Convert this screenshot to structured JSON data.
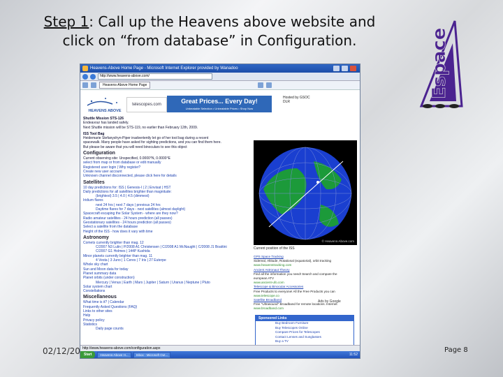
{
  "slide": {
    "title_step": "Step 1",
    "title_rest_line1": ": Call up the Heavens above website and",
    "title_line2": "click on “from database” in Configuration.",
    "date": "02/12/20",
    "page": "Page 8",
    "logo_text": "Espace"
  },
  "browser": {
    "title": "Heavens-Above Home Page - Microsoft Internet Explorer provided by Wanadoo",
    "address": "http://www.heavens-above.com/",
    "tab": "Heavens-Above Home Page",
    "status_url": "http://www.heavens-above.com/configuration.aspx",
    "start_label": "Start",
    "task1": "Heavens-Above H...",
    "task2": "Inbox - Microsoft Out...",
    "clock": "11:52"
  },
  "site": {
    "logo_text": "HEAVENS ABOVE",
    "ad1_text": "telescopes.com",
    "ad2_title": "Great Prices... Every Day!",
    "ad2_sub": "Unbeatable Selection  •  Unbeatable Prices  •  Shop Now",
    "dlr_text": "Hosted by GSOC DLR",
    "news1_title": "Shuttle Mission STS-126",
    "news1_l1": "Endeavour has landed safely.",
    "news1_l2": "Next Shuttle mission will be STS-119, no earlier than February 12th, 2009.",
    "news2_title": "ISS Tool Bag",
    "news2_l1": "Heidemarie Stefanyshyn-Piper inadvertently let go of her tool bag during a recent",
    "news2_l2": "spacewalk. Many people have asked for sighting predictions, and you can find them here.",
    "news2_l3": "But please be aware that you will need binoculars to see this object",
    "config_h": "Configuration",
    "config_l1": "Current observing site: Unspecified, 0.0000°N, 0.0000°E",
    "config_l2": "select from map or from database or edit manually",
    "config_l3": "Registered user login | Why register?",
    "config_l4": "Create new user account",
    "config_l5": "Unknown channel disconnected, please click here for details",
    "sat_h": "Satellites",
    "sat_l1": "10 day predictions for: ISS | Genesis-I | 2 | Envisat | HST",
    "sat_l2": "Daily predictions for all satellites brighter than magnitude:",
    "sat_l3": "(brightest) 3.5 | 4.0 | 4.5 (dimmest)",
    "sat_l4": "Iridium flares",
    "sat_l5": "next 24 hrs | next 7 days | previous 24 hrs",
    "sat_l6": "Daytime flares for 7 days - next satellites (almost daylight)",
    "sat_l7": "Spacecraft escaping the Solar System - where are they now?",
    "sat_l8": "Radio amateur satellites - 24 hours prediction (all passes)",
    "sat_l9": "Geostationary satellites - 24 hours prediction (all passes)",
    "sat_l10": "Select a satellite from the database",
    "sat_l11": "Height of the ISS - how does it vary with time",
    "astro_h": "Astronomy",
    "astro_l1": "Comets currently brighter than mag. 12",
    "astro_l2": "C/2007 N3 Lulin | P/2008 A1 Christensen | C/2008 A1 McNaught | C/2008 J1 Boattini",
    "astro_l3": "C/2007 G1 Holmes | 144P Kushida",
    "astro_l4": "Minor planets currently brighter than mag. 11",
    "astro_l5": "4 Vesta | 3 Juno | 1 Ceres | 7 Iris | 27 Euterpe",
    "astro_l6": "Whole sky chart",
    "astro_l7": "Sun and Moon data for today",
    "astro_l8": "Planet summary data",
    "astro_l9": "Planet orbits (under construction)",
    "astro_l10": "Mercury | Venus | Earth | Mars | Jupiter | Saturn | Uranus | Neptune | Pluto",
    "astro_l11": "Solar system chart",
    "astro_l12": "Constellations",
    "misc_h": "Miscellaneous",
    "misc_l1": "What time is it? | Calendar",
    "misc_l2": "Frequently Asked Questions (FAQ)",
    "misc_l3": "Links to other sites",
    "misc_l4": "Help",
    "misc_l5": "Privacy policy",
    "misc_l6": "Statistics",
    "misc_l7": "Daily page counts",
    "globe_caption": "Current position of the ISS",
    "globe_credit": "© Heavens-Above.com",
    "right_l1": "GPS Space Tracking",
    "right_l2": "Sidereal, Altitude, Rotational (equatorial), orbit tracking",
    "right_l3": "www.heavenstracking.com",
    "right_l4": "Ancient Astronaut Theory",
    "right_l5": "Find all the information you need! Search and compare the",
    "right_l6": "european ATV",
    "right_l7": "www.ancient-ufo.com",
    "right_l8": "Telescope & Binocular Accessories",
    "right_l9": "Free Products to everyone! All the Free Products you can",
    "right_l10": "www.telescope.co",
    "right_l11": "Satellite Broadband",
    "right_l12": "Free \"Ultrasound\" Broadband for remote locations. Internet",
    "right_l13": "www.broadband.com",
    "ads_by_google": "Ads by Google",
    "sponsored_h": "Sponsored Links",
    "sponsored_1": "Buy Bedroom Furniture",
    "sponsored_2": "Buy Telescopes Online",
    "sponsored_3": "Compare Prices for Telescopes",
    "sponsored_4": "Contact Lenses and Sunglasses",
    "sponsored_5": "Buy a TV"
  },
  "colors": {
    "logo_purple": "#4b2390",
    "window_blue": "#2f66c4",
    "globe_ocean": "#1a3fd0",
    "globe_land": "#1c9a3a"
  },
  "icons": [
    "back-icon",
    "forward-icon",
    "star-icon",
    "home-icon",
    "shuttle-icon",
    "earth-globe-icon",
    "windows-start-icon"
  ]
}
